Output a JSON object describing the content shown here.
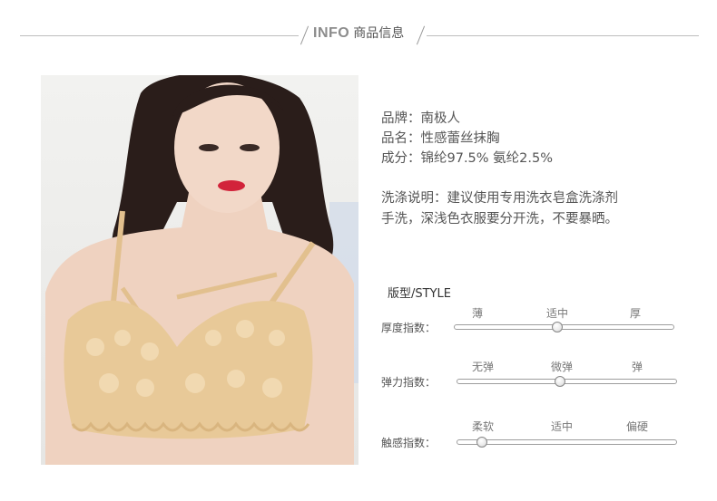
{
  "header": {
    "title_en": "INFO",
    "title_cn": "商品信息"
  },
  "photo": {
    "alt": ""
  },
  "info": {
    "brand": "品牌：南极人",
    "name": "品名：性感蕾丝抹胸",
    "material": "成分：锦纶97.5%  氨纶2.5%",
    "wash_line1": "洗涤说明：建议使用专用洗衣皂盒洗涤剂",
    "wash_line2": "手洗，深浅色衣服要分开洗，不要暴晒。"
  },
  "style": {
    "title": "版型/STYLE",
    "rows": [
      {
        "label": "厚度指数：",
        "ticks": [
          "薄",
          "适中",
          "厚"
        ],
        "level": 0.47
      },
      {
        "label": "弹力指数：",
        "ticks": [
          "无弹",
          "微弹",
          "弹"
        ],
        "level": 0.47
      },
      {
        "label": "触感指数：",
        "ticks": [
          "柔软",
          "适中",
          "偏硬"
        ],
        "level": 0.11
      }
    ]
  },
  "colors": {
    "lace": "#e8c998",
    "skin": "#efd2c0",
    "hair": "#2a1d1a",
    "lips": "#d2233a"
  }
}
